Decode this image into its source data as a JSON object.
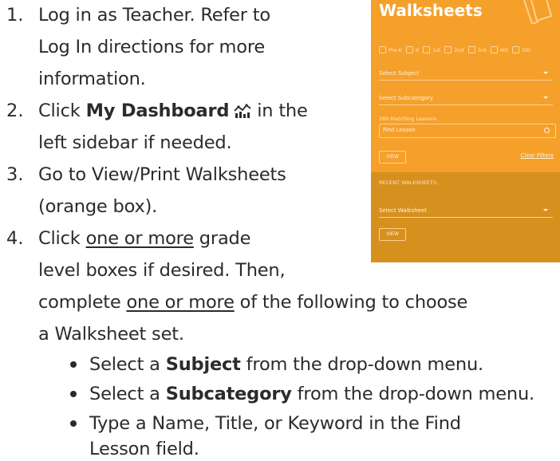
{
  "steps": {
    "s1": {
      "num": "1.",
      "l1": "Log in as Teacher. Refer to",
      "l2": "Log In directions for more",
      "l3": "information."
    },
    "s2": {
      "num": "2.",
      "pre": "Click ",
      "bold": "My Dashboard",
      "post": " in the",
      "l2": "left sidebar if needed."
    },
    "s3": {
      "num": "3.",
      "l1": "Go to View/Print Walksheets",
      "l2": "(orange box)."
    },
    "s4": {
      "num": "4.",
      "l1_pre": "Click ",
      "l1_ul": "one or more",
      "l1_post": " grade",
      "l2": "level boxes if desired. Then,",
      "l3_pre": "complete ",
      "l3_ul": "one or more",
      "l3_post": " of the following to choose",
      "l4": "a Walksheet set."
    }
  },
  "bullets": {
    "b1": {
      "pre": "Select a ",
      "bold": "Subject",
      "post": " from the drop-down menu."
    },
    "b2": {
      "pre": "Select a ",
      "bold": "Subcategory",
      "post": " from the drop-down menu."
    },
    "b3": {
      "l1": "Type a Name, Title, or Keyword in the Find",
      "l2": "Lesson field."
    }
  },
  "panel": {
    "title": "Walksheets",
    "grades": [
      "Pre-K",
      "K",
      "1st",
      "2nd",
      "3rd",
      "4th",
      "5th"
    ],
    "subject_placeholder": "Select Subject",
    "subcategory_placeholder": "Select Subcategory",
    "matching": "280 Matching Lessons",
    "find_placeholder": "Find Lesson",
    "view_label": "VIEW",
    "clear_filters": "Clear Filters",
    "recent_label": "RECENT WALKSHEETS:",
    "walksheet_placeholder": "Select Walksheet",
    "view2_label": "VIEW"
  },
  "colors": {
    "panel": "#f5a02b",
    "panel_dark": "#d6901e"
  },
  "icons": {
    "dashboard": "dashboard-chart-icon",
    "panel": "pages-icon"
  }
}
